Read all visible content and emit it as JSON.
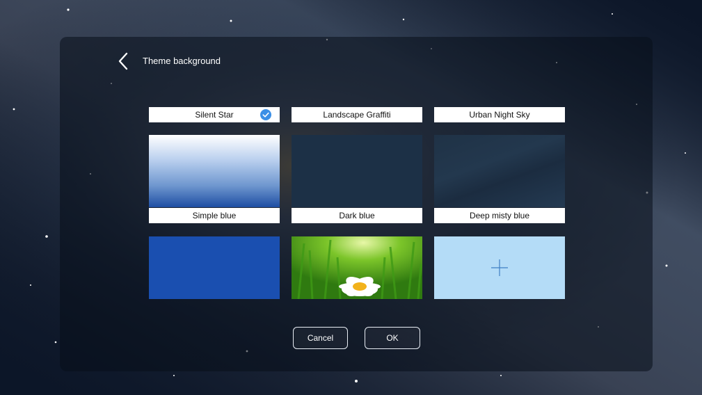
{
  "header": {
    "title": "Theme background"
  },
  "themes": [
    {
      "label": "Silent Star",
      "selected": true
    },
    {
      "label": "Landscape Graffiti",
      "selected": false
    },
    {
      "label": "Urban Night Sky",
      "selected": false
    },
    {
      "label": "Simple blue",
      "selected": false
    },
    {
      "label": "Dark blue",
      "selected": false
    },
    {
      "label": "Deep misty blue",
      "selected": false
    }
  ],
  "custom_tile": {
    "icon": "plus-icon"
  },
  "footer": {
    "cancel_label": "Cancel",
    "ok_label": "OK"
  },
  "colors": {
    "accent": "#3b8fe6",
    "simple_blue": "#1a4fb0",
    "dark_blue": "#1c3046",
    "add_tile": "#b4dcf7"
  }
}
